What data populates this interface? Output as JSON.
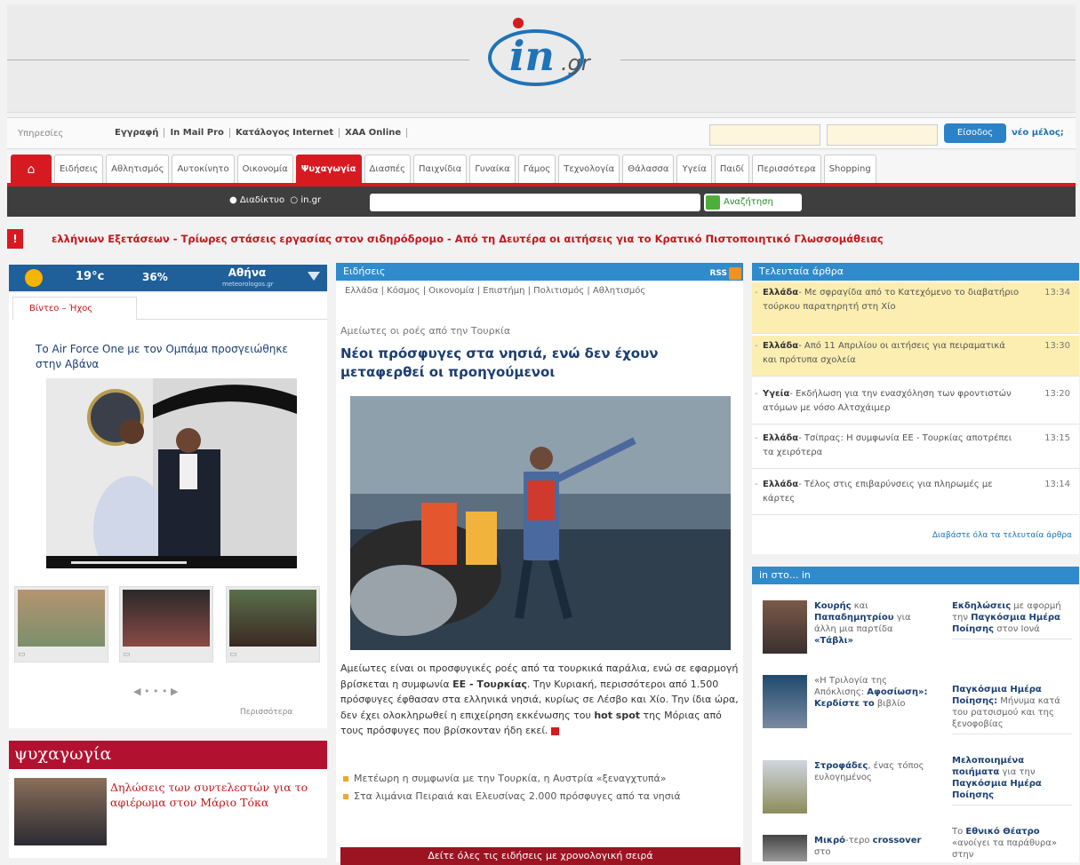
{
  "header": {
    "logo_main": "in",
    "logo_suffix": ".gr"
  },
  "util": {
    "services": "Υπηρεσίες",
    "links": [
      "Εγγραφή",
      "In Mail Pro",
      "Κατάλογος Internet",
      "ΧΑΑ Online"
    ],
    "login": "Είσοδος",
    "new_member": "νέο μέλος;"
  },
  "nav": {
    "tabs": [
      "Ειδήσεις",
      "Αθλητισμός",
      "Αυτοκίνητο",
      "Οικονομία",
      "Ψυχαγωγία",
      "Διασπές",
      "Παιχνίδια",
      "Γυναίκα",
      "Γάμος",
      "Τεχνολογία",
      "Θάλασσα",
      "Υγεία",
      "Παιδί",
      "Περισσότερα",
      "Shopping"
    ],
    "active": "Ψυχαγωγία"
  },
  "search": {
    "opt_web": "Διαδίκτυο",
    "opt_site": "in.gr",
    "button": "Αναζήτηση"
  },
  "ticker": {
    "text": "ελλήνιων Εξετάσεων   -   Τρίωρες στάσεις εργασίας στον σιδηρόδρομο   -   Από τη Δευτέρα οι αιτήσεις για το Κρατικό Πιστοποιητικό Γλωσσομάθειας"
  },
  "weather": {
    "temp": "19°c",
    "humidity": "36%",
    "city": "Αθήνα",
    "source": "meteorologos.gr"
  },
  "left": {
    "tab": "Βίντεο – Ήχος",
    "video_title": "Το Air Force One με τον Ομπάμα προσγειώθηκε στην Αβάνα",
    "pager": "• • •",
    "more": "Περισσότερα"
  },
  "psyx": {
    "title": "ψυχαγωγία",
    "story": "Δηλώσεις των συντελεστών για το αφιέρωμα στον Μάριο Τόκα"
  },
  "news": {
    "header": "Ειδήσεις",
    "rss": "RSS",
    "cats": "Ελλάδα | Κόσμος | Οικονομία | Επιστήμη | Πολιτισμός | Αθλητισμός",
    "kicker": "Αμείωτες οι ροές από την Τουρκία",
    "headline": "Νέοι πρόσφυγες στα νησιά, ενώ δεν έχουν μεταφερθεί οι προηγούμενοι",
    "body_1": "Αμείωτες είναι οι προσφυγικές ροές από τα τουρκικά παράλια, ενώ σε εφαρμογή βρίσκεται η συμφωνία ",
    "body_bold_1": "ΕΕ - Τουρκίας",
    "body_2": ". Την Κυριακή, περισσότεροι από 1.500 πρόσφυγες έφθασαν στα ελληνικά νησιά, κυρίως σε Λέσβο και Χίο. Την ίδια ώρα, δεν έχει ολοκληρωθεί η επιχείρηση εκκένωσης του ",
    "body_bold_2": "hot spot",
    "body_3": " της Μόριας από τους πρόσφυγες που βρίσκονταν ήδη εκεί.",
    "bullets": [
      "Μετέωρη η συμφωνία με την Τουρκία, η Αυστρία «ξεναγχτυπά»",
      "Στα λιμάνια Πειραιά και Ελευσίνας 2.000 πρόσφυγες από τα νησιά"
    ],
    "all_button": "Δείτε όλες τις ειδήσεις με χρονολογική σειρά"
  },
  "latest": {
    "header": "Τελευταία άρθρα",
    "items": [
      {
        "cat": "Ελλάδα",
        "text": "- Με σφραγίδα από το Κατεχόμενο το διαβατήριο τούρκου παρατηρητή στη Χίο",
        "time": "13:34"
      },
      {
        "cat": "Ελλάδα",
        "text": "- Από 11 Απριλίου οι αιτήσεις για πειραματικά και πρότυπα σχολεία",
        "time": "13:30"
      },
      {
        "cat": "Υγεία",
        "text": "- Εκδήλωση για την ενασχόληση των φροντιστών ατόμων με νόσο Αλτσχάιμερ",
        "time": "13:20"
      },
      {
        "cat": "Ελλάδα",
        "text": "- Τσίπρας: Η συμφωνία ΕΕ - Τουρκίας αποτρέπει τα χειρότερα",
        "time": "13:15"
      },
      {
        "cat": "Ελλάδα",
        "text": "- Τέλος στις επιβαρύνσεις για πληρωμές με κάρτες",
        "time": "13:14"
      }
    ],
    "all": "Διαβάστε όλα τα τελευταία άρθρα"
  },
  "inst": {
    "header": "in στο... in",
    "left": [
      {
        "b": "Κουρής",
        "t1": " και ",
        "b2": "Παπαδημητρίου",
        "t2": " για άλλη μια παρτίδα ",
        "b3": "«Τάβλι»"
      },
      {
        "b": "",
        "t1": "«Η Τριλογία της Απόκλισης: ",
        "b2": "Αφοσίωση»: Κερδίστε το",
        "t2": " βιβλίο",
        "b3": ""
      },
      {
        "b": "Στροφάδες",
        "t1": ", ένας τόπος ευλογημένος",
        "b2": "",
        "t2": "",
        "b3": ""
      },
      {
        "b": "Μικρό",
        "t1": "-τερο ",
        "b2": "crossover",
        "t2": " στο",
        "b3": ""
      }
    ],
    "right": [
      {
        "b": "Εκδηλώσεις",
        "t": " με αφορμή την ",
        "b2": "Παγκόσμια Ημέρα Ποίησης",
        "t2": " στον Ιονά"
      },
      {
        "b": "Παγκόσμια Ημέρα Ποίησης:",
        "t": " Μήνυμα κατά του ρατσισμού και της ξενοφοβίας",
        "b2": "",
        "t2": ""
      },
      {
        "b": "Μελοποιημένα ποιήματα",
        "t": " για την ",
        "b2": "Παγκόσμια Ημέρα Ποίησης",
        "t2": ""
      },
      {
        "b": "",
        "t": "Το ",
        "b2": "Εθνικό Θέατρο",
        "t2": " «ανοίγει τα παράθυρα» στην"
      }
    ]
  }
}
